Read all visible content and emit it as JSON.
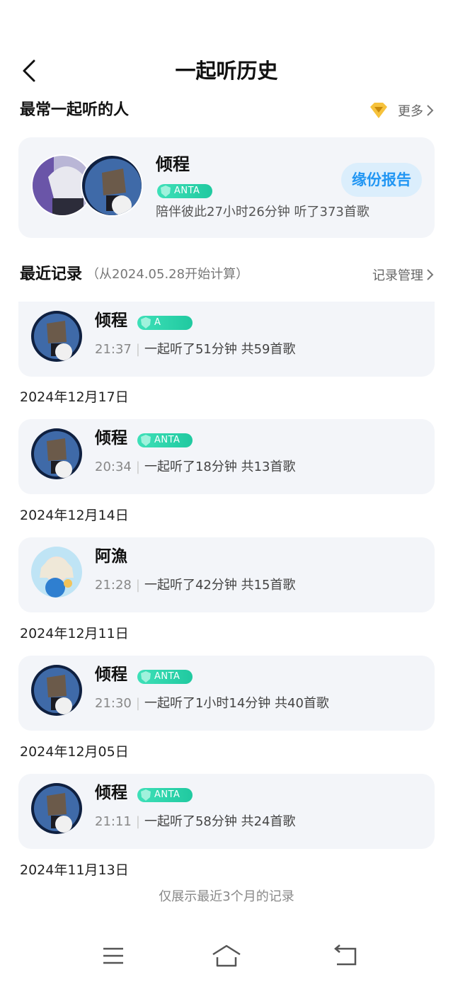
{
  "header": {
    "title": "一起听历史"
  },
  "frequent": {
    "section_title": "最常一起听的人",
    "more_label": "更多",
    "name": "倾程",
    "badge_text": "ANTA",
    "summary": "陪伴彼此27小时26分钟 听了373首歌",
    "report_button": "缘份报告"
  },
  "recent": {
    "section_title": "最近记录",
    "section_sub": "（从2024.05.28开始计算）",
    "manage_label": "记录管理"
  },
  "records": [
    {
      "name": "倾程",
      "badge_text": "A",
      "time": "21:37",
      "detail": "一起听了51分钟 共59首歌"
    },
    {
      "name": "倾程",
      "badge_text": "ANTA",
      "time": "20:34",
      "detail": "一起听了18分钟 共13首歌"
    },
    {
      "name": "阿漁",
      "badge_text": "",
      "time": "21:28",
      "detail": "一起听了42分钟 共15首歌"
    },
    {
      "name": "倾程",
      "badge_text": "ANTA",
      "time": "21:30",
      "detail": "一起听了1小时14分钟 共40首歌"
    },
    {
      "name": "倾程",
      "badge_text": "ANTA",
      "time": "21:11",
      "detail": "一起听了58分钟 共24首歌"
    }
  ],
  "dates": [
    "2024年12月17日",
    "2024年12月14日",
    "2024年12月11日",
    "2024年12月05日",
    "2024年11月13日"
  ],
  "footer": {
    "note": "仅展示最近3个月的记录"
  },
  "colors": {
    "accent_blue": "#2196f3",
    "badge_green": "#20c9a0",
    "card_bg": "#f3f5f9"
  }
}
